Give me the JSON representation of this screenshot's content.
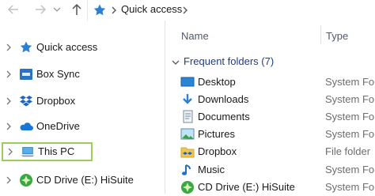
{
  "address_bar": {
    "breadcrumb": "Quick access"
  },
  "nav_pane": {
    "items": [
      {
        "label": "Quick access"
      },
      {
        "label": "Box Sync"
      },
      {
        "label": "Dropbox"
      },
      {
        "label": "OneDrive"
      },
      {
        "label": "This PC",
        "selected": true
      },
      {
        "label": "CD Drive (E:) HiSuite"
      }
    ]
  },
  "content": {
    "columns": {
      "name": "Name",
      "type": "Type"
    },
    "group_header": "Frequent folders (7)",
    "folders": [
      {
        "name": "Desktop",
        "type": "System Folde"
      },
      {
        "name": "Downloads",
        "type": "System Folde"
      },
      {
        "name": "Documents",
        "type": "System Folde"
      },
      {
        "name": "Pictures",
        "type": "System Folde"
      },
      {
        "name": "Dropbox",
        "type": "File folder"
      },
      {
        "name": "Music",
        "type": "System Folde"
      },
      {
        "name": "CD Drive (E:) HiSuite",
        "type": "System Folde"
      }
    ]
  },
  "colors": {
    "selection_border": "#9ccc5a",
    "group_text": "#1e3c8c",
    "quick_access_star": "#2b7fd4"
  }
}
